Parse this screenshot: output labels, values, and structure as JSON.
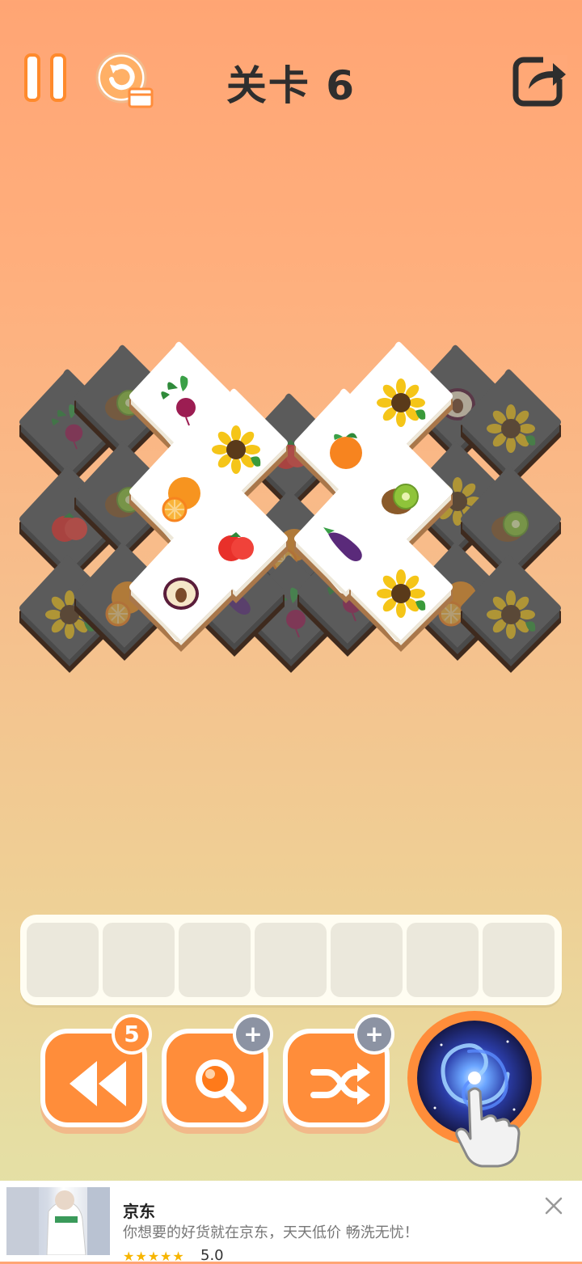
{
  "header": {
    "level_title": "关卡 6"
  },
  "icons": {
    "pause": "pause-icon",
    "restart": "restart-video-icon",
    "share": "share-icon"
  },
  "colors": {
    "accent": "#ff8d3a",
    "text": "#2e2e2e",
    "tile_top": "#ffffff",
    "tile_base": "#5a5a5a"
  },
  "board": {
    "top_tiles": [
      "beet",
      "sunflower",
      "sunflower",
      "orange",
      "orange-citrus",
      "kiwi",
      "tomato",
      "eggplant",
      "plum",
      "sunflower"
    ],
    "covered_tiles": [
      "beet",
      "kiwi",
      "tomato",
      "sunflower",
      "kiwi",
      "citrus",
      "kiwi",
      "plum",
      "sunflower",
      "kiwi",
      "sunflower",
      "citrus",
      "citrus",
      "eggplant",
      "beet"
    ]
  },
  "tray": {
    "slots": 7
  },
  "tools": {
    "undo": {
      "badge": "5",
      "icon": "rewind-icon"
    },
    "hint": {
      "badge": "+",
      "icon": "magnifier-icon"
    },
    "shuffle": {
      "badge": "+",
      "icon": "shuffle-icon"
    },
    "vortex": {
      "icon": "vortex-icon"
    }
  },
  "ad": {
    "title": "京东",
    "description": "你想要的好货就在京东，天天低价 畅洗无忧！",
    "stars": "★★★★★",
    "rating": "5.0"
  }
}
